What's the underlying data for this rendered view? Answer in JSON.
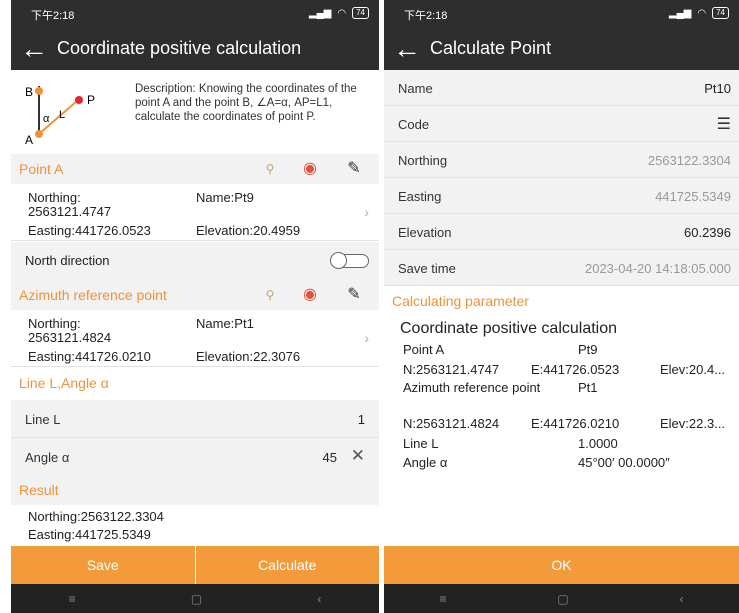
{
  "status": {
    "time": "下午2:18",
    "signal": "⁴ᴳ",
    "battery": "74"
  },
  "left": {
    "title": "Coordinate positive calculation",
    "description": "Description: Knowing the coordinates of the point A and the point B, ∠A=α, AP=L1, calculate the coordinates of point P.",
    "diagram": {
      "label_b": "B",
      "label_a": "A",
      "label_p": "P",
      "label_alpha": "α",
      "label_l": "L"
    },
    "point_a": {
      "header": "Point A",
      "northing": "Northing:",
      "northing_value": "2563121.4747",
      "name": "Name:Pt9",
      "easting": "Easting:441726.0523",
      "elevation": "Elevation:20.4959"
    },
    "north_direction": "North direction",
    "azimuth": {
      "header": "Azimuth reference point",
      "northing": "Northing:",
      "northing_value": "2563121.4824",
      "name": "Name:Pt1",
      "easting": "Easting:441726.0210",
      "elevation": "Elevation:22.3076"
    },
    "line_angle_header": "Line L,Angle α",
    "line_l": {
      "label": "Line L",
      "value": "1"
    },
    "angle": {
      "label": "Angle α",
      "value": "45"
    },
    "result": {
      "header": "Result",
      "northing": "Northing:2563122.3304",
      "easting": "Easting:441725.5349"
    },
    "save_label": "Save",
    "calculate_label": "Calculate"
  },
  "right": {
    "title": "Calculate Point",
    "fields": [
      {
        "label": "Name",
        "value": "Pt10"
      },
      {
        "label": "Code",
        "value": ""
      },
      {
        "label": "Northing",
        "value": "2563122.3304"
      },
      {
        "label": "Easting",
        "value": "441725.5349"
      },
      {
        "label": "Elevation",
        "value": "60.2396"
      },
      {
        "label": "Save time",
        "value": "2023-04-20 14:18:05.000"
      }
    ],
    "param_header": "Calculating parameter",
    "param_title": "Coordinate positive calculation",
    "point_a_label": "Point A",
    "point_a_name": "Pt9",
    "point_a_n": "N:2563121.4747",
    "point_a_e": "E:441726.0523",
    "point_a_elev": "Elev:20.4...",
    "azimuth_label": "Azimuth reference point",
    "azimuth_name": "Pt1",
    "azimuth_n": "N:2563121.4824",
    "azimuth_e": "E:441726.0210",
    "azimuth_elev": "Elev:22.3...",
    "line_l_label": "Line L",
    "line_l_value": "1.0000",
    "angle_label": "Angle α",
    "angle_value": "45°00′ 00.0000″",
    "ok_label": "OK"
  },
  "colors": {
    "accent": "#f39a3b",
    "appbar": "#2e2e2e",
    "section_bg": "#f2f2f2"
  }
}
